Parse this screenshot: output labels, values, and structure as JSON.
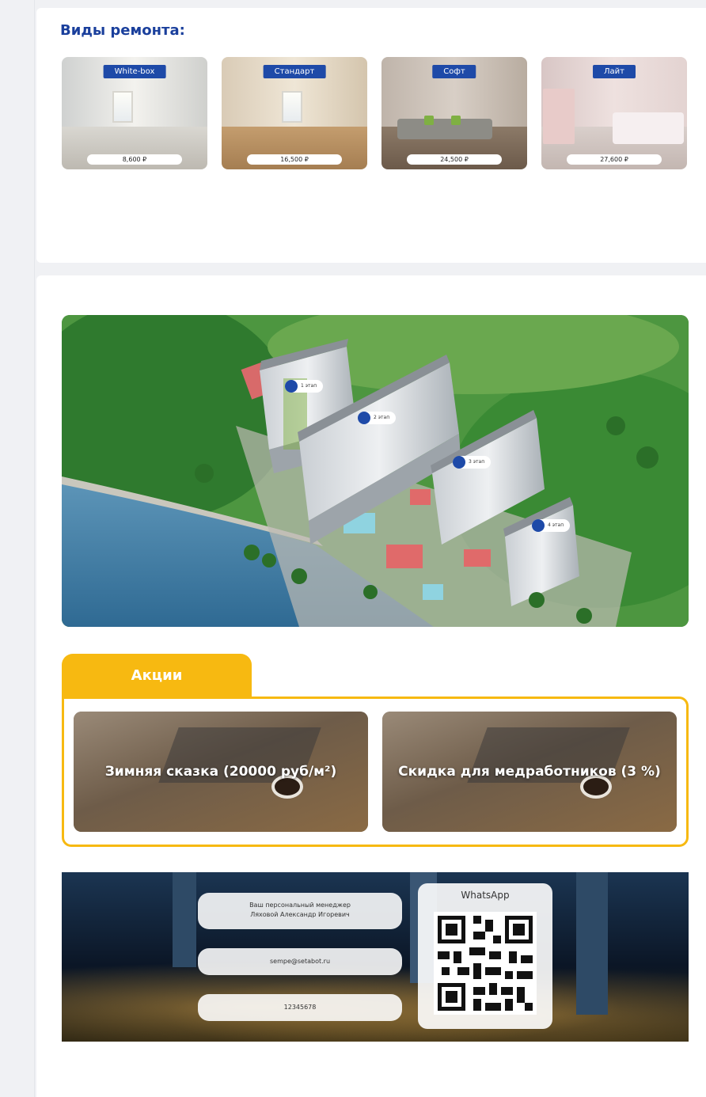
{
  "repair": {
    "title": "Виды ремонта:",
    "items": [
      {
        "label": "White-box",
        "price": "8,600 ₽"
      },
      {
        "label": "Стандарт",
        "price": "16,500 ₽"
      },
      {
        "label": "Софт",
        "price": "24,500 ₽"
      },
      {
        "label": "Лайт",
        "price": "27,600 ₽"
      }
    ]
  },
  "complex": {
    "pins": [
      {
        "label": "1 этап"
      },
      {
        "label": "2 этап"
      },
      {
        "label": "3 этап"
      },
      {
        "label": "4 этап"
      }
    ]
  },
  "promotions": {
    "tab_label": "Акции",
    "items": [
      {
        "title": "Зимняя сказка (20000 руб/м²)"
      },
      {
        "title": "Скидка для медработников (3 %)"
      }
    ]
  },
  "contacts": {
    "manager_line1": "Ваш персональный менеджер",
    "manager_line2": "Ляховой Александр Игоревич",
    "email": "sempe@setabot.ru",
    "phone": "12345678",
    "qr_title": "WhatsApp"
  },
  "colors": {
    "accent_blue": "#1e4aa8",
    "title_blue": "#1a3f9c",
    "promo_yellow": "#f7b911"
  }
}
